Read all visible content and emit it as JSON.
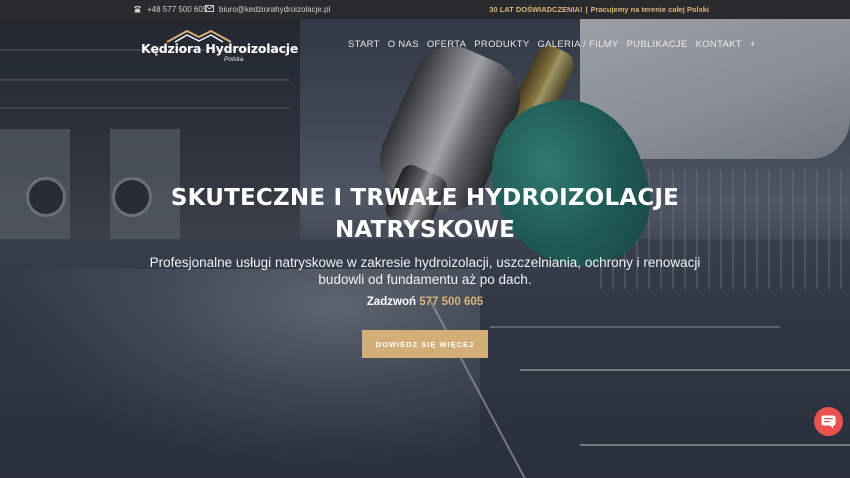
{
  "topbar": {
    "phone_icon": "phone-icon",
    "phone": "+48 577 500 605",
    "email_icon": "envelope-icon",
    "email": "biuro@kedziorahydroizolacje.pl",
    "promo_bold": "30 LAT DOŚWIADCZENIA!",
    "promo_sep": "|",
    "promo_rest": "Pracujemy na terenie całej Polski"
  },
  "header": {
    "logo_name": "Kędziora Hydroizolacje",
    "logo_sub": "Polska",
    "nav": [
      {
        "label": "START"
      },
      {
        "label": "O NAS"
      },
      {
        "label": "OFERTA"
      },
      {
        "label": "PRODUKTY"
      },
      {
        "label": "GALERIA / FILMY"
      },
      {
        "label": "PUBLIKACJE"
      },
      {
        "label": "KONTAKT"
      },
      {
        "label": "+"
      }
    ]
  },
  "hero": {
    "title_line1": "SKUTECZNE I TRWAŁE HYDROIZOLACJE",
    "title_line2": "NATRYSKOWE",
    "lead": "Profesjonalne usługi natryskowe w zakresie hydroizolacji, uszczelniania, ochrony i renowacji budowli od fundamentu aż po dach.",
    "call_prefix": "Zadzwoń",
    "call_number": "577 500 605",
    "cta": "DOWIEDZ SIĘ WIĘCEJ"
  },
  "colors": {
    "accent": "#d4ae78",
    "topbar": "#2a2a2c",
    "chat": "#e9524f"
  },
  "chat": {
    "icon": "chat-bubble-icon"
  }
}
